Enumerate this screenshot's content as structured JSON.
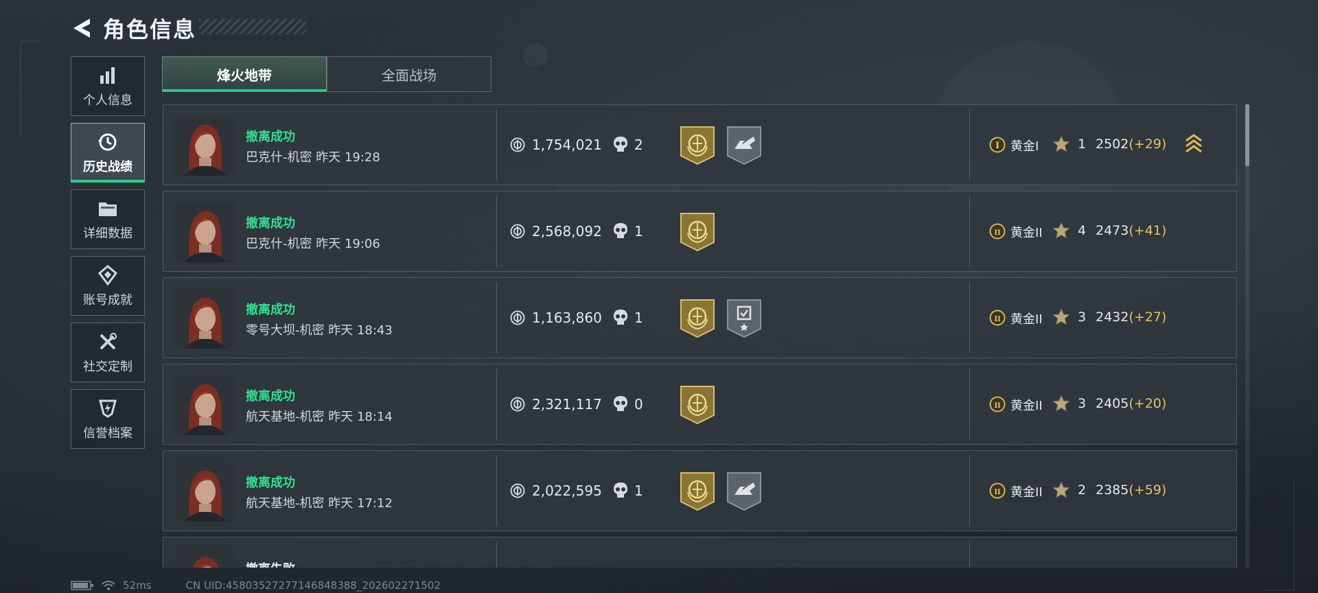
{
  "header": {
    "title": "角色信息"
  },
  "sidebar": {
    "items": [
      {
        "label": "个人信息",
        "icon": "bar-chart-icon",
        "active": false
      },
      {
        "label": "历史战绩",
        "icon": "history-clock-icon",
        "active": true
      },
      {
        "label": "详细数据",
        "icon": "folder-icon",
        "active": false
      },
      {
        "label": "账号成就",
        "icon": "achievement-icon",
        "active": false
      },
      {
        "label": "社交定制",
        "icon": "tools-icon",
        "active": false
      },
      {
        "label": "信誉档案",
        "icon": "credit-shield-icon",
        "active": false
      }
    ]
  },
  "tabs": [
    {
      "label": "烽火地带",
      "active": true
    },
    {
      "label": "全面战场",
      "active": false
    }
  ],
  "records": [
    {
      "status": "撤离成功",
      "map_time": "巴克什-机密 昨天 19:28",
      "value": "1,754,021",
      "kills": "2",
      "badges": [
        "gold-emblem-badge",
        "gray-hand-badge"
      ],
      "rank_numeral": "I",
      "rank": "黄金I",
      "stars": "1",
      "score": "2502",
      "delta": "(+29)",
      "promotion": true
    },
    {
      "status": "撤离成功",
      "map_time": "巴克什-机密 昨天 19:06",
      "value": "2,568,092",
      "kills": "1",
      "badges": [
        "gold-emblem-badge"
      ],
      "rank_numeral": "II",
      "rank": "黄金II",
      "stars": "4",
      "score": "2473",
      "delta": "(+41)",
      "promotion": false
    },
    {
      "status": "撤离成功",
      "map_time": "零号大坝-机密 昨天 18:43",
      "value": "1,163,860",
      "kills": "1",
      "badges": [
        "gold-emblem-badge",
        "gray-task-badge"
      ],
      "rank_numeral": "II",
      "rank": "黄金II",
      "stars": "3",
      "score": "2432",
      "delta": "(+27)",
      "promotion": false
    },
    {
      "status": "撤离成功",
      "map_time": "航天基地-机密 昨天 18:14",
      "value": "2,321,117",
      "kills": "0",
      "badges": [
        "gold-emblem-badge"
      ],
      "rank_numeral": "II",
      "rank": "黄金II",
      "stars": "3",
      "score": "2405",
      "delta": "(+20)",
      "promotion": false
    },
    {
      "status": "撤离成功",
      "map_time": "航天基地-机密 昨天 17:12",
      "value": "2,022,595",
      "kills": "1",
      "badges": [
        "gold-emblem-badge",
        "gray-hand-badge"
      ],
      "rank_numeral": "II",
      "rank": "黄金II",
      "stars": "2",
      "score": "2385",
      "delta": "(+59)",
      "promotion": false
    },
    {
      "status": "撤离失败",
      "map_time": "",
      "value": "",
      "kills": "",
      "badges": [],
      "rank_numeral": "",
      "rank": "",
      "stars": "",
      "score": "",
      "delta": "",
      "promotion": false
    }
  ],
  "footer": {
    "ping": "52ms",
    "uid": "CN UID:45803527277146848388_202602271502"
  },
  "colors": {
    "accent_green": "#25d08b",
    "success_text": "#2fe08f",
    "gold": "#e8c45c"
  }
}
